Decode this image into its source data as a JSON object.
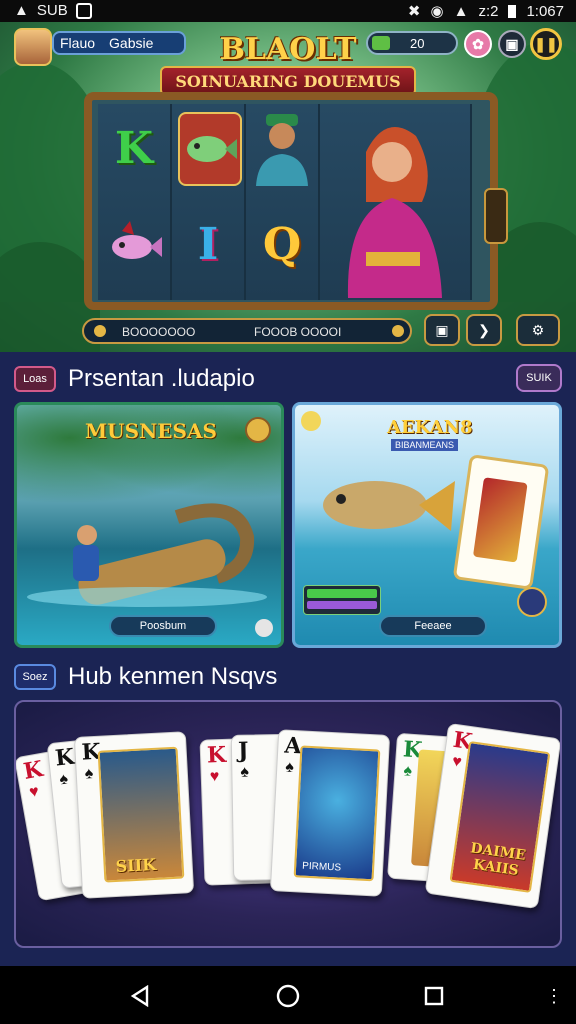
{
  "status_bar": {
    "carrier": "SUB",
    "signal_text": "z:2",
    "time": "1:067"
  },
  "header": {
    "player_name": "Flauo",
    "player_level": "Gabsie",
    "coin_balance": "20"
  },
  "hero": {
    "logo": "BLAOLT",
    "banner": "SOINUARING DOUEMUS",
    "bet_left": "BOOOOOOO",
    "bet_right": "FOOOB OOOOI"
  },
  "section1": {
    "tag": "Loas",
    "title": "Prsentan .ludapio",
    "sort_label": "SUIK"
  },
  "games": [
    {
      "title": "MUSNESAS",
      "button": "Poosbum"
    },
    {
      "title": "AEKAN8",
      "subtitle": "BIBANMEANS",
      "button": "Feeaee"
    }
  ],
  "section2": {
    "tag": "Soez",
    "title": "Hub kenmen Nsqvs"
  },
  "showcase": {
    "card_texts": [
      "SIIK",
      "PIRMUS",
      "DAIME KAIIS"
    ]
  },
  "colors": {
    "accent_gold": "#e4b645",
    "panel_navy": "#1b2454",
    "purple_border": "#b07acc"
  }
}
